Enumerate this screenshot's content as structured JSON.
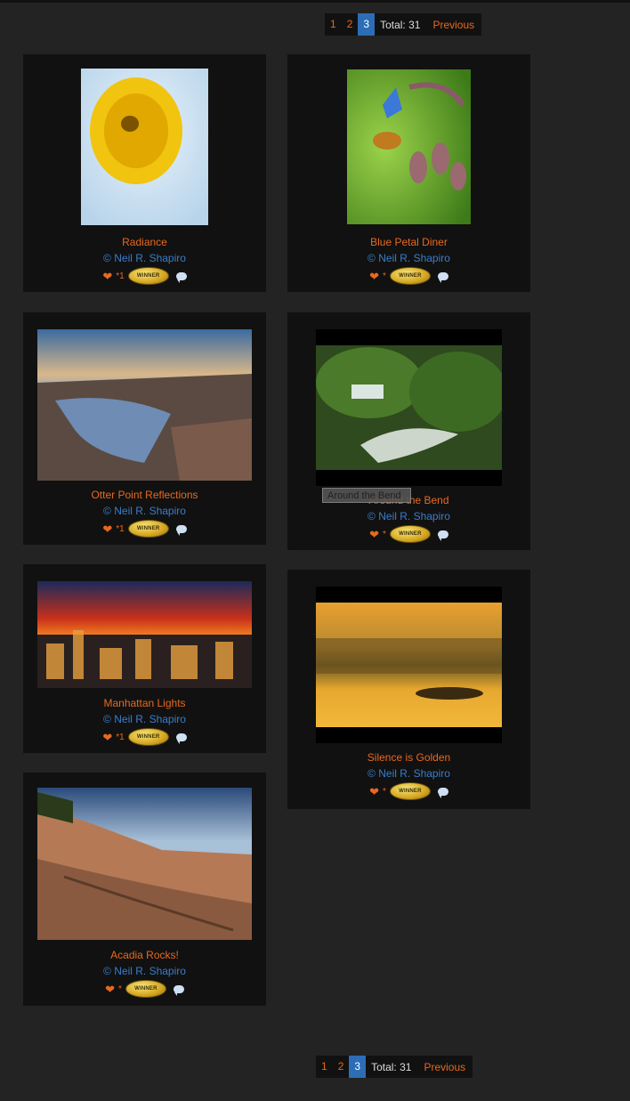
{
  "pagination": {
    "pages": [
      "1",
      "2",
      "3"
    ],
    "active_page": "3",
    "total": "Total: 31",
    "previous": "Previous"
  },
  "photos": [
    {
      "title": "Radiance",
      "credit": "© Neil R. Shapiro",
      "likes": "*1",
      "badge": "WINNER"
    },
    {
      "title": "Blue Petal Diner",
      "credit": "© Neil R. Shapiro",
      "likes": "*",
      "badge": "WINNER"
    },
    {
      "title": "Otter Point Reflections",
      "credit": "© Neil R. Shapiro",
      "likes": "*1",
      "badge": "WINNER"
    },
    {
      "title": "Around the Bend",
      "credit": "© Neil R. Shapiro",
      "likes": "*",
      "badge": "WINNER"
    },
    {
      "title": "Manhattan Lights",
      "credit": "© Neil R. Shapiro",
      "likes": "*1",
      "badge": "WINNER"
    },
    {
      "title": "Silence is Golden",
      "credit": "© Neil R. Shapiro",
      "likes": "*",
      "badge": "WINNER"
    },
    {
      "title": "Acadia Rocks!",
      "credit": "© Neil R. Shapiro",
      "likes": "*",
      "badge": "WINNER"
    }
  ],
  "tooltip": "Around the Bend",
  "icons": {
    "like": "heart-icon",
    "award": "winner-badge-icon",
    "comment": "comment-bubble-icon"
  },
  "colors": {
    "accent": "#e8691d",
    "credit": "#3a7dc9",
    "active_page": "#2d6db5",
    "card": "#111111",
    "background": "#232323"
  }
}
